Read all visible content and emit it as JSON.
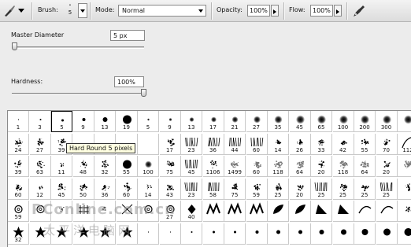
{
  "options_bar": {
    "brush_label": "Brush:",
    "brush_size": "5",
    "mode_label": "Mode:",
    "mode_value": "Normal",
    "opacity_label": "Opacity:",
    "opacity_value": "100%",
    "flow_label": "Flow:",
    "flow_value": "100%"
  },
  "brush_panel": {
    "master_diameter_label": "Master Diameter",
    "master_diameter_value": "5 px",
    "master_diameter_level": 0.02,
    "hardness_label": "Hardness:",
    "hardness_value": "100%",
    "hardness_level": 1.0
  },
  "tooltip": "Hard Round 5 pixels",
  "watermark": {
    "line1": "PConline.com.cn",
    "line2": "太平洋电脑网"
  },
  "presets": {
    "selected_index": 2,
    "rows": [
      [
        {
          "label": "1",
          "icon": "hard-round",
          "d": 1
        },
        {
          "label": "3",
          "icon": "hard-round",
          "d": 2
        },
        {
          "label": "5",
          "icon": "hard-round",
          "d": 3
        },
        {
          "label": "9",
          "icon": "hard-round",
          "d": 4
        },
        {
          "label": "13",
          "icon": "hard-round",
          "d": 6
        },
        {
          "label": "19",
          "icon": "hard-round",
          "d": 11
        },
        {
          "label": "5",
          "icon": "soft-round",
          "d": 3
        },
        {
          "label": "9",
          "icon": "soft-round",
          "d": 4
        },
        {
          "label": "13",
          "icon": "soft-round",
          "d": 6
        },
        {
          "label": "17",
          "icon": "soft-round",
          "d": 7
        },
        {
          "label": "21",
          "icon": "soft-round",
          "d": 8
        },
        {
          "label": "27",
          "icon": "soft-round",
          "d": 9
        },
        {
          "label": "35",
          "icon": "soft-round",
          "d": 10
        },
        {
          "label": "45",
          "icon": "soft-round",
          "d": 11
        },
        {
          "label": "65",
          "icon": "soft-round",
          "d": 11
        },
        {
          "label": "100",
          "icon": "soft-round",
          "d": 11
        },
        {
          "label": "200",
          "icon": "soft-round",
          "d": 11
        },
        {
          "label": "300",
          "icon": "soft-round",
          "d": 11
        },
        {
          "label": "",
          "icon": "soft-round",
          "d": 11
        }
      ],
      [
        {
          "label": "24",
          "icon": "scatter",
          "d": 10
        },
        {
          "label": "27",
          "icon": "scatter",
          "d": 10
        },
        {
          "label": "39",
          "icon": "scatter",
          "d": 10
        },
        {
          "label": "",
          "icon": "blank",
          "d": 0
        },
        {
          "label": "",
          "icon": "blank",
          "d": 0
        },
        {
          "label": "",
          "icon": "blank",
          "d": 0
        },
        {
          "label": "",
          "icon": "blank",
          "d": 0
        },
        {
          "label": "17",
          "icon": "scatter",
          "d": 10
        },
        {
          "label": "23",
          "icon": "grass",
          "d": 10
        },
        {
          "label": "36",
          "icon": "grass",
          "d": 10
        },
        {
          "label": "44",
          "icon": "grass",
          "d": 10
        },
        {
          "label": "60",
          "icon": "grass",
          "d": 10
        },
        {
          "label": "14",
          "icon": "scatter",
          "d": 6
        },
        {
          "label": "26",
          "icon": "scatter",
          "d": 8
        },
        {
          "label": "33",
          "icon": "scatter",
          "d": 8
        },
        {
          "label": "42",
          "icon": "scatter",
          "d": 8
        },
        {
          "label": "55",
          "icon": "scatter",
          "d": 9
        },
        {
          "label": "70",
          "icon": "scatter",
          "d": 9
        },
        {
          "label": "112",
          "icon": "stroke",
          "d": 10
        }
      ],
      [
        {
          "label": "39",
          "icon": "scatter",
          "d": 10
        },
        {
          "label": "63",
          "icon": "scatter",
          "d": 10
        },
        {
          "label": "11",
          "icon": "dots",
          "d": 6
        },
        {
          "label": "48",
          "icon": "scatter",
          "d": 10
        },
        {
          "label": "32",
          "icon": "scatter",
          "d": 10
        },
        {
          "label": "55",
          "icon": "hard-round",
          "d": 11
        },
        {
          "label": "100",
          "icon": "soft-round",
          "d": 9
        },
        {
          "label": "75",
          "icon": "scatter",
          "d": 10
        },
        {
          "label": "45",
          "icon": "grass",
          "d": 10
        },
        {
          "label": "1106",
          "icon": "scatter",
          "d": 10
        },
        {
          "label": "1499",
          "icon": "texture",
          "d": 10
        },
        {
          "label": "60",
          "icon": "texture",
          "d": 10
        },
        {
          "label": "118",
          "icon": "texture",
          "d": 10
        },
        {
          "label": "64",
          "icon": "texture",
          "d": 10
        },
        {
          "label": "20",
          "icon": "scatter",
          "d": 9
        },
        {
          "label": "118",
          "icon": "texture",
          "d": 10
        },
        {
          "label": "64",
          "icon": "texture",
          "d": 10
        },
        {
          "label": "20",
          "icon": "scatter",
          "d": 9
        },
        {
          "label": "",
          "icon": "texture",
          "d": 10
        }
      ],
      [
        {
          "label": "60",
          "icon": "scatter",
          "d": 10
        },
        {
          "label": "12",
          "icon": "dots",
          "d": 6
        },
        {
          "label": "45",
          "icon": "scatter",
          "d": 10
        },
        {
          "label": "50",
          "icon": "scatter",
          "d": 10
        },
        {
          "label": "36",
          "icon": "scatter",
          "d": 10
        },
        {
          "label": "60",
          "icon": "scatter",
          "d": 10
        },
        {
          "label": "14",
          "icon": "dots",
          "d": 7
        },
        {
          "label": "43",
          "icon": "scatter",
          "d": 10
        },
        {
          "label": "23",
          "icon": "grass",
          "d": 10
        },
        {
          "label": "58",
          "icon": "grass",
          "d": 10
        },
        {
          "label": "75",
          "icon": "scatter",
          "d": 10
        },
        {
          "label": "59",
          "icon": "scatter",
          "d": 10
        },
        {
          "label": "25",
          "icon": "scatter",
          "d": 9
        },
        {
          "label": "20",
          "icon": "scatter",
          "d": 9
        },
        {
          "label": "25",
          "icon": "grass",
          "d": 10
        },
        {
          "label": "25",
          "icon": "scatter",
          "d": 9
        },
        {
          "label": "25",
          "icon": "scatter",
          "d": 9
        },
        {
          "label": "25",
          "icon": "grass",
          "d": 10
        },
        {
          "label": "",
          "icon": "scatter",
          "d": 9
        }
      ],
      [
        {
          "label": "59",
          "icon": "ring",
          "d": 9
        },
        {
          "label": "",
          "icon": "ring",
          "d": 9
        },
        {
          "label": "",
          "icon": "dots",
          "d": 8
        },
        {
          "label": "",
          "icon": "hash",
          "d": 9
        },
        {
          "label": "",
          "icon": "dots",
          "d": 8
        },
        {
          "label": "",
          "icon": "cross",
          "d": 9
        },
        {
          "label": "",
          "icon": "ring",
          "d": 9
        },
        {
          "label": "27",
          "icon": "ring",
          "d": 9
        },
        {
          "label": "40",
          "icon": "diamond",
          "d": 7
        },
        {
          "label": "",
          "icon": "zigzag",
          "d": 10
        },
        {
          "label": "",
          "icon": "zigzag",
          "d": 10
        },
        {
          "label": "",
          "icon": "zigzag",
          "d": 10
        },
        {
          "label": "",
          "icon": "leaf",
          "d": 10
        },
        {
          "label": "",
          "icon": "leaf",
          "d": 10
        },
        {
          "label": "",
          "icon": "wedge",
          "d": 10
        },
        {
          "label": "",
          "icon": "wedge",
          "d": 10
        },
        {
          "label": "",
          "icon": "curve",
          "d": 9
        },
        {
          "label": "",
          "icon": "curve",
          "d": 9
        },
        {
          "label": "",
          "icon": "dots",
          "d": 8
        }
      ],
      [
        {
          "label": "32",
          "icon": "star",
          "d": 10
        },
        {
          "label": "",
          "icon": "star",
          "d": 10
        },
        {
          "label": "",
          "icon": "star",
          "d": 10
        },
        {
          "label": "",
          "icon": "star",
          "d": 10
        },
        {
          "label": "",
          "icon": "star",
          "d": 10
        },
        {
          "label": "",
          "icon": "star",
          "d": 10
        },
        {
          "label": "",
          "icon": "hard-round",
          "d": 1
        },
        {
          "label": "",
          "icon": "hard-round",
          "d": 1
        },
        {
          "label": "",
          "icon": "hard-round",
          "d": 2
        },
        {
          "label": "",
          "icon": "hard-round",
          "d": 3
        },
        {
          "label": "",
          "icon": "hard-round",
          "d": 3
        },
        {
          "label": "",
          "icon": "hard-round",
          "d": 4
        },
        {
          "label": "",
          "icon": "hard-round",
          "d": 5
        },
        {
          "label": "",
          "icon": "hard-round",
          "d": 5
        },
        {
          "label": "",
          "icon": "hard-round",
          "d": 6
        },
        {
          "label": "",
          "icon": "hard-round",
          "d": 7
        },
        {
          "label": "",
          "icon": "hard-round",
          "d": 8
        },
        {
          "label": "",
          "icon": "hard-round",
          "d": 9
        },
        {
          "label": "",
          "icon": "hard-round",
          "d": 10
        }
      ]
    ]
  }
}
